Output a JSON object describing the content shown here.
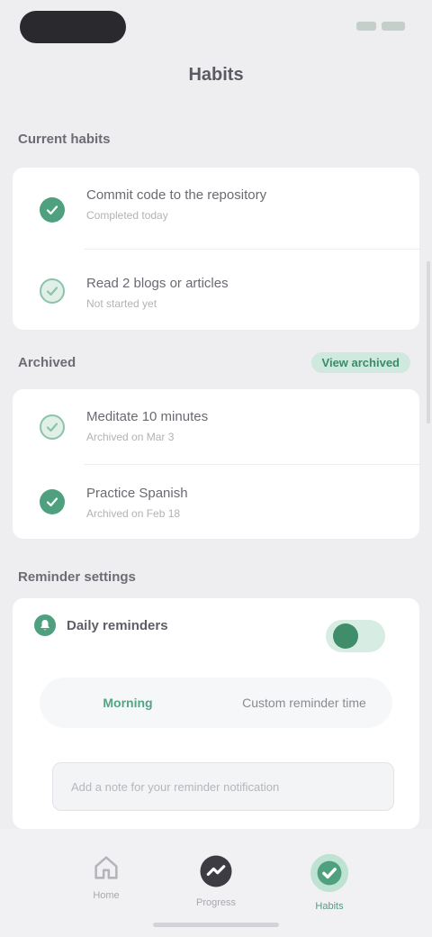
{
  "header": {
    "title": "Habits",
    "status_icons": [
      "signal-icon",
      "battery-icon"
    ]
  },
  "sections": [
    {
      "title": "Current habits",
      "rows": [
        {
          "title": "Commit code to the repository",
          "subtitle": "Completed today",
          "state": "checked",
          "icon": "check-icon"
        },
        {
          "title": "Read 2 blogs or articles",
          "subtitle": "Not started yet",
          "state": "unchecked",
          "icon": "check-icon"
        }
      ]
    },
    {
      "title": "Archived",
      "action": "View archived",
      "rows": [
        {
          "title": "Meditate 10 minutes",
          "subtitle": "Archived on Mar 3",
          "state": "unchecked",
          "icon": "check-icon"
        },
        {
          "title": "Practice Spanish",
          "subtitle": "Archived on Feb 18",
          "state": "checked",
          "icon": "check-icon"
        }
      ]
    },
    {
      "title": "Reminder settings",
      "toggle_row": {
        "title": "Daily reminders",
        "enabled": true,
        "icon": "bell-icon"
      },
      "segments": [
        "Morning",
        "Custom reminder time"
      ],
      "active_segment": 0,
      "note_placeholder": "Add a note for your reminder notification"
    }
  ],
  "bottom_nav": [
    {
      "label": "Home",
      "icon": "home-icon",
      "active": false
    },
    {
      "label": "Progress",
      "icon": "progress-icon",
      "active": false
    },
    {
      "label": "Habits",
      "icon": "habits-icon",
      "active": true
    }
  ],
  "colors": {
    "accent": "#4fa07e",
    "accent_light": "#d7ece2",
    "background": "#eeeef1",
    "card": "#ffffff"
  }
}
